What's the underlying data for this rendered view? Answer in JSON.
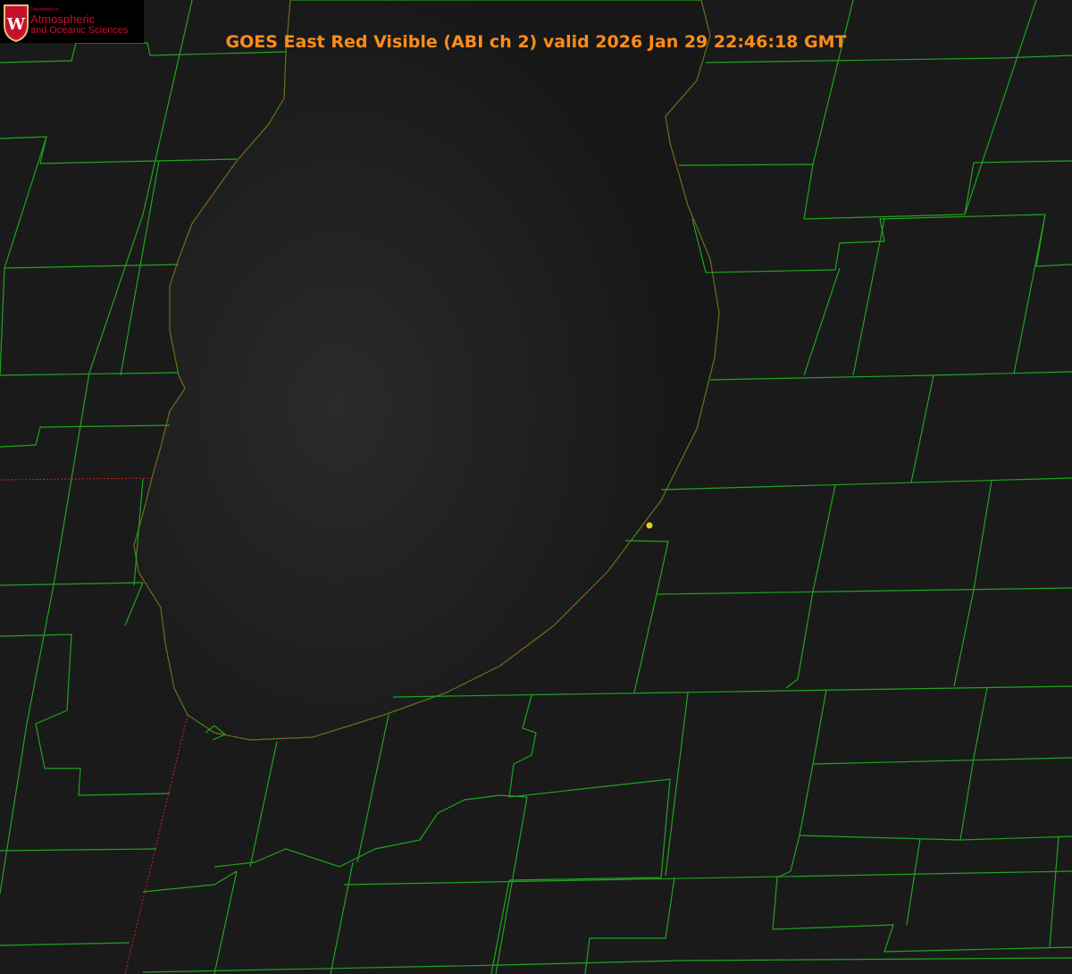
{
  "title": "GOES East Red Visible (ABI ch 2) valid 2026 Jan 29 22:46:18 GMT",
  "logo": {
    "department": "Department of",
    "line1": "Atmospheric",
    "line2": "and Oceanic Sciences",
    "crest_letter": "W"
  },
  "colors": {
    "background": "#1a1a1a",
    "lake": "#161616",
    "boundaries": "#1fa31f",
    "state_line": "#d02020",
    "title": "#ff8c1a",
    "marker": "#e0d020"
  }
}
